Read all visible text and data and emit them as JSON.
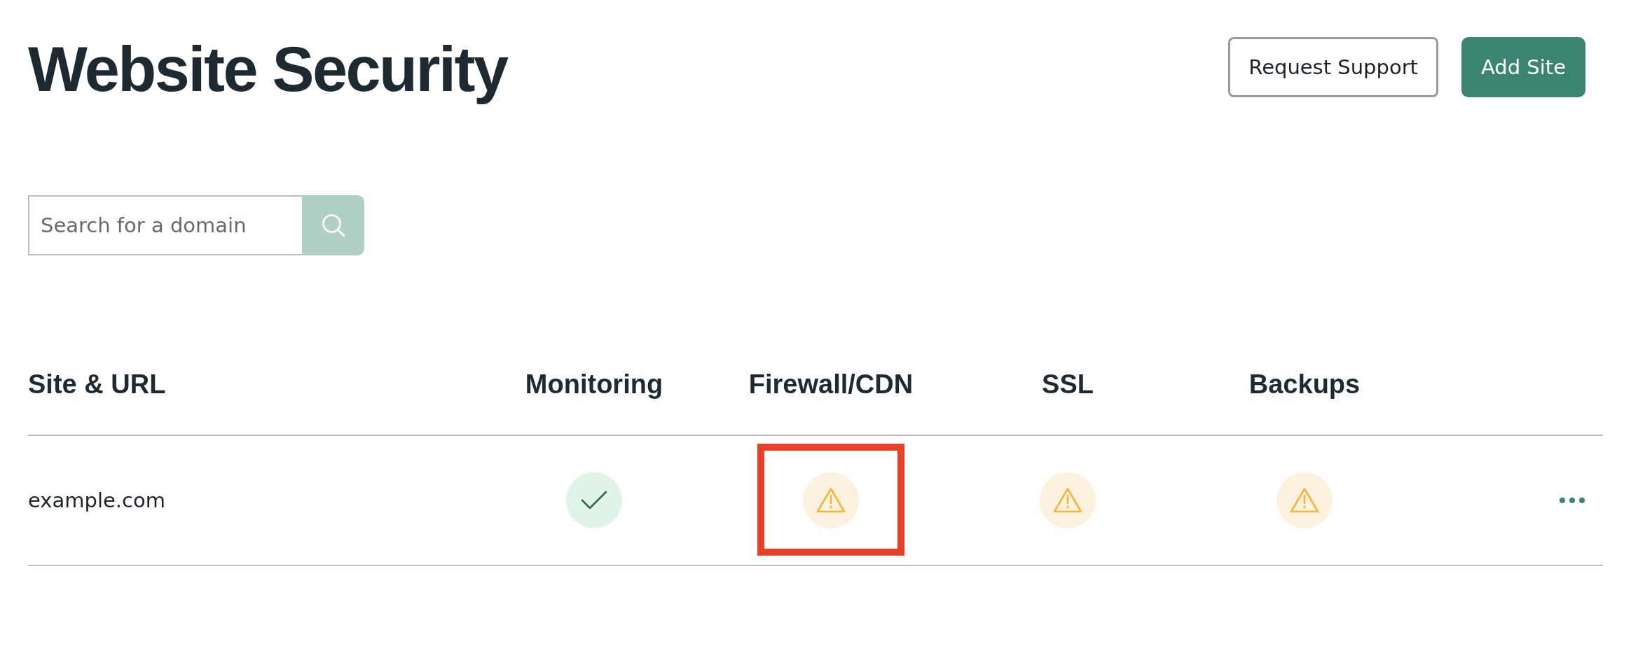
{
  "page": {
    "title": "Website Security"
  },
  "header_buttons": [
    {
      "label": "Request Support",
      "kind": "secondary"
    },
    {
      "label": "Add Site",
      "kind": "primary"
    }
  ],
  "search": {
    "placeholder": "Search for a domain"
  },
  "table": {
    "columns": [
      "Site & URL",
      "Monitoring",
      "Firewall/CDN",
      "SSL",
      "Backups"
    ],
    "rows": [
      {
        "site": "example.com",
        "checks": [
          {
            "kind": "ok",
            "highlighted": false
          },
          {
            "kind": "warning",
            "highlighted": true
          },
          {
            "kind": "warning",
            "highlighted": false
          },
          {
            "kind": "warning",
            "highlighted": false
          }
        ]
      }
    ]
  }
}
